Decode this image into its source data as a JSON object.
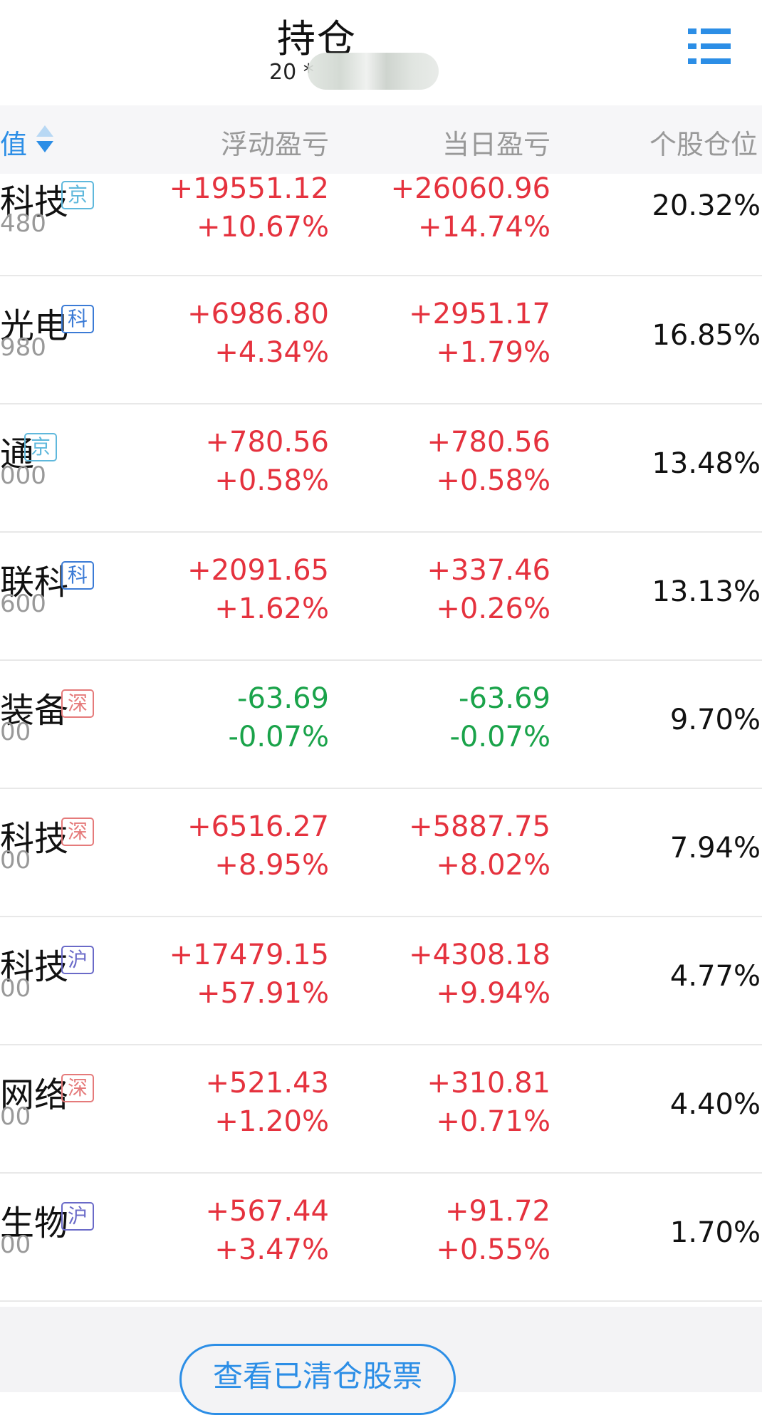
{
  "header": {
    "title": "持仓",
    "account_prefix": "20 *"
  },
  "columns": {
    "sort_col": "值",
    "floating_pl": "浮动盈亏",
    "daily_pl": "当日盈亏",
    "position_pct": "个股仓位"
  },
  "colors": {
    "up": "#e5323e",
    "down": "#1aa34a",
    "accent": "#2c8ee6",
    "badge_jing": "#5fb8dc",
    "badge_ke": "#3b7bd6",
    "badge_shen": "#e57a7a",
    "badge_hu": "#6a6ac8"
  },
  "holdings": [
    {
      "name": "科技",
      "badge": "京",
      "code": "480",
      "float_amt": "+19551.12",
      "float_pct": "+10.67%",
      "day_amt": "+26060.96",
      "day_pct": "+14.74%",
      "pos": "20.32%",
      "dir": "up"
    },
    {
      "name": "光电",
      "badge": "科",
      "code": "980",
      "float_amt": "+6986.80",
      "float_pct": "+4.34%",
      "day_amt": "+2951.17",
      "day_pct": "+1.79%",
      "pos": "16.85%",
      "dir": "up"
    },
    {
      "name": "通",
      "badge": "京",
      "code": "000",
      "float_amt": "+780.56",
      "float_pct": "+0.58%",
      "day_amt": "+780.56",
      "day_pct": "+0.58%",
      "pos": "13.48%",
      "dir": "up"
    },
    {
      "name": "联科",
      "badge": "科",
      "code": "600",
      "float_amt": "+2091.65",
      "float_pct": "+1.62%",
      "day_amt": "+337.46",
      "day_pct": "+0.26%",
      "pos": "13.13%",
      "dir": "up"
    },
    {
      "name": "装备",
      "badge": "深",
      "code": "00",
      "float_amt": "-63.69",
      "float_pct": "-0.07%",
      "day_amt": "-63.69",
      "day_pct": "-0.07%",
      "pos": "9.70%",
      "dir": "down"
    },
    {
      "name": "科技",
      "badge": "深",
      "code": "00",
      "float_amt": "+6516.27",
      "float_pct": "+8.95%",
      "day_amt": "+5887.75",
      "day_pct": "+8.02%",
      "pos": "7.94%",
      "dir": "up"
    },
    {
      "name": "科技",
      "badge": "沪",
      "code": "00",
      "float_amt": "+17479.15",
      "float_pct": "+57.91%",
      "day_amt": "+4308.18",
      "day_pct": "+9.94%",
      "pos": "4.77%",
      "dir": "up"
    },
    {
      "name": "网络",
      "badge": "深",
      "code": "00",
      "float_amt": "+521.43",
      "float_pct": "+1.20%",
      "day_amt": "+310.81",
      "day_pct": "+0.71%",
      "pos": "4.40%",
      "dir": "up"
    },
    {
      "name": "生物",
      "badge": "沪",
      "code": "00",
      "float_amt": "+567.44",
      "float_pct": "+3.47%",
      "day_amt": "+91.72",
      "day_pct": "+0.55%",
      "pos": "1.70%",
      "dir": "up"
    }
  ],
  "footer": {
    "cleared_button": "查看已清仓股票"
  }
}
